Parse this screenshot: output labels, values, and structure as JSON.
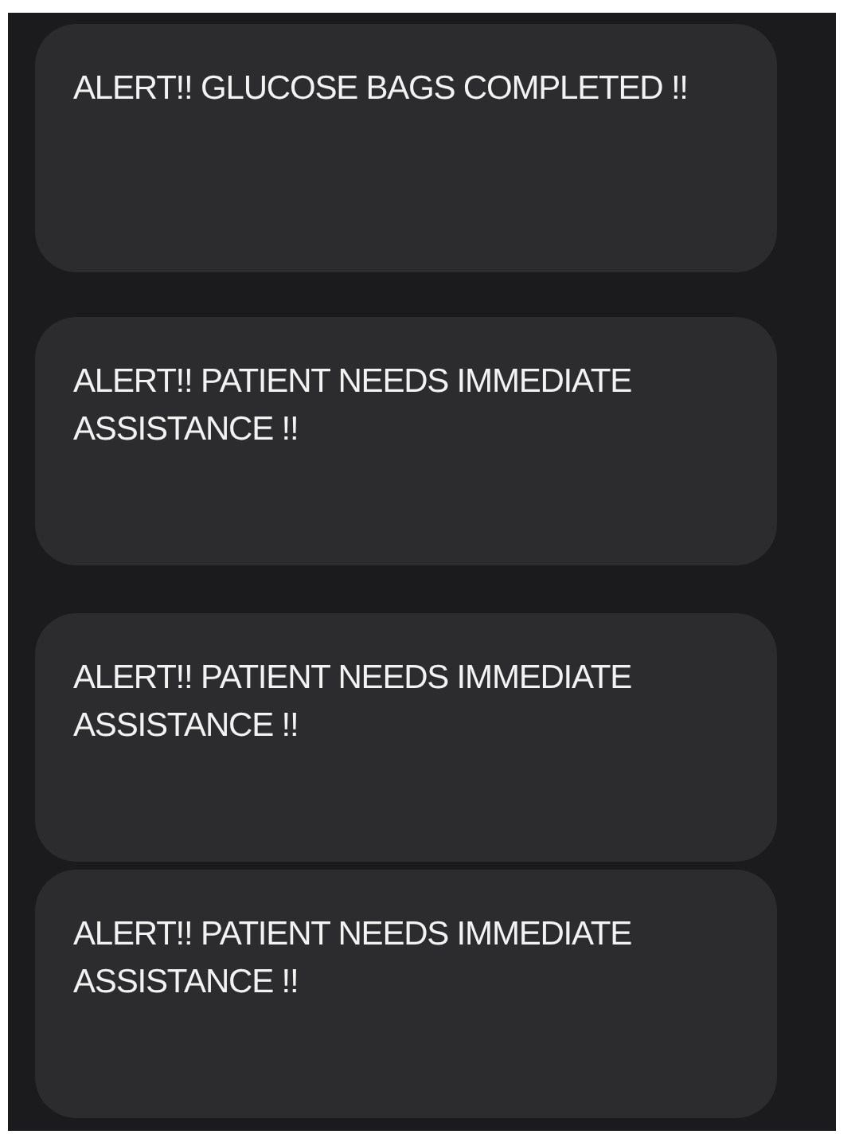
{
  "notifications": [
    {
      "message": "ALERT!! GLUCOSE BAGS COMPLETED !!"
    },
    {
      "message": "ALERT!! PATIENT NEEDS IMMEDIATE ASSISTANCE !!"
    },
    {
      "message": "ALERT!! PATIENT NEEDS IMMEDIATE ASSISTANCE !!"
    },
    {
      "message": "ALERT!! PATIENT NEEDS IMMEDIATE ASSISTANCE !!"
    }
  ]
}
